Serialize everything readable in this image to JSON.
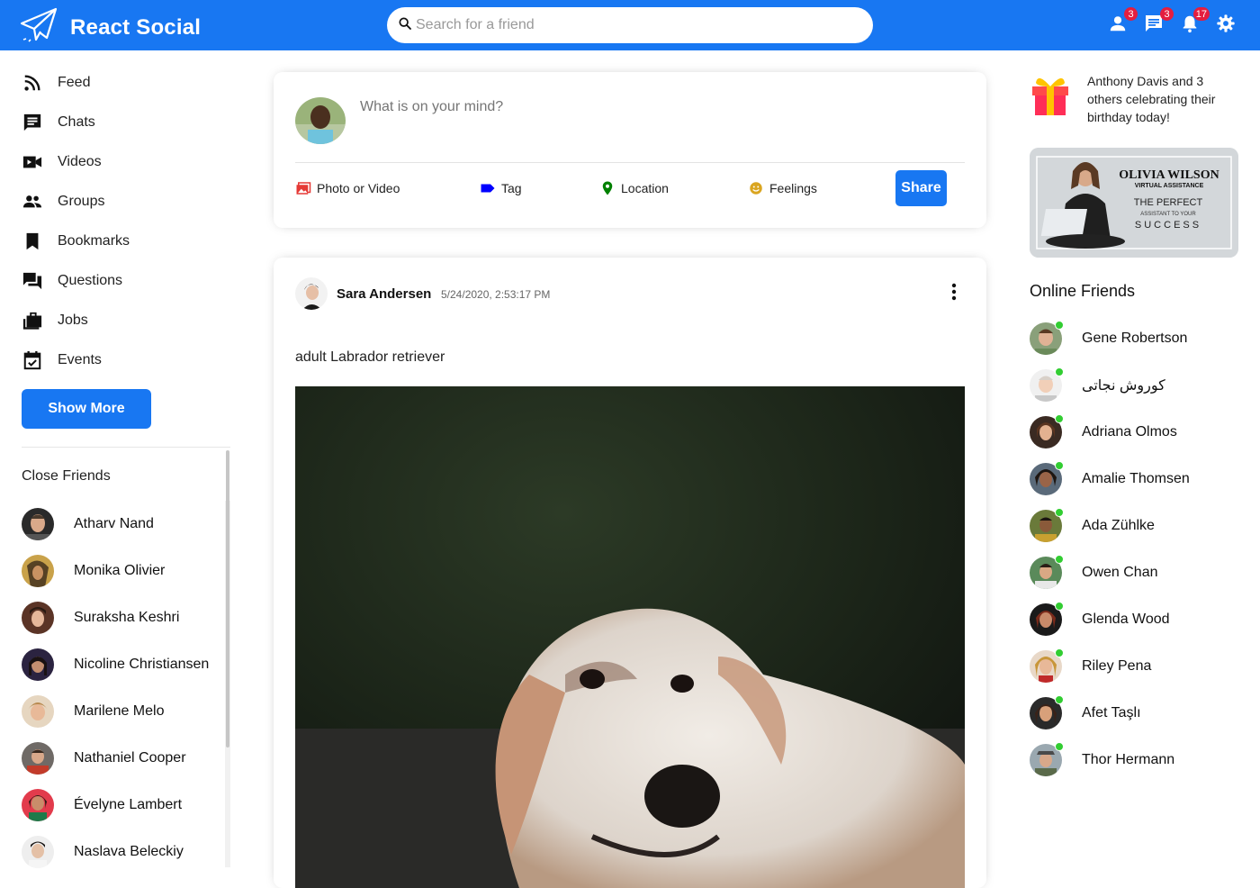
{
  "app": {
    "title": "React Social"
  },
  "search": {
    "placeholder": "Search for a friend"
  },
  "top_icons": [
    {
      "icon": "person-icon",
      "badge": "3"
    },
    {
      "icon": "chat-icon",
      "badge": "3"
    },
    {
      "icon": "bell-icon",
      "badge": "17"
    },
    {
      "icon": "gear-icon"
    }
  ],
  "sidebar": {
    "items": [
      {
        "label": "Feed",
        "icon": "rss-feed-icon"
      },
      {
        "label": "Chats",
        "icon": "chat-bubble-icon"
      },
      {
        "label": "Videos",
        "icon": "video-camera-icon"
      },
      {
        "label": "Groups",
        "icon": "group-icon"
      },
      {
        "label": "Bookmarks",
        "icon": "bookmark-icon"
      },
      {
        "label": "Questions",
        "icon": "forum-icon"
      },
      {
        "label": "Jobs",
        "icon": "work-icon"
      },
      {
        "label": "Events",
        "icon": "calendar-icon"
      }
    ],
    "show_more": "Show More",
    "close_friends_title": "Close Friends",
    "close_friends": [
      "Atharv Nand",
      "Monika Olivier",
      "Suraksha Keshri",
      "Nicoline Christiansen",
      "Marilene Melo",
      "Nathaniel Cooper",
      "Évelyne Lambert",
      "Naslava Beleckiy"
    ]
  },
  "share": {
    "placeholder": "What is on your mind?",
    "options": [
      {
        "label": "Photo or Video",
        "icon": "photo-icon",
        "color": "#e53935"
      },
      {
        "label": "Tag",
        "icon": "label-icon",
        "color": "#0000ff"
      },
      {
        "label": "Location",
        "icon": "location-pin-icon",
        "color": "#008000"
      },
      {
        "label": "Feelings",
        "icon": "emoji-icon",
        "color": "#daa520"
      }
    ],
    "button": "Share"
  },
  "post": {
    "username": "Sara Andersen",
    "date": "5/24/2020, 2:53:17 PM",
    "text": "adult Labrador retriever"
  },
  "birthday": {
    "name": "Anthony Davis",
    "rest": " and 3 others celebrating their birthday today!"
  },
  "ad": {
    "line1": "OLIVIA WILSON",
    "line2": "VIRTUAL ASSISTANCE",
    "line3": "THE PERFECT",
    "line4": "ASSISTANT TO YOUR",
    "line5": "SUCCESS"
  },
  "online_friends": {
    "title": "Online Friends",
    "list": [
      "Gene Robertson",
      "کوروش نجاتی",
      "Adriana Olmos",
      "Amalie Thomsen",
      "Ada Zühlke",
      "Owen Chan",
      "Glenda Wood",
      "Riley Pena",
      "Afet Taşlı",
      "Thor Hermann"
    ]
  },
  "colors": {
    "brand": "#1877f2",
    "online": "#32cd32",
    "badge": "#e41e3f"
  }
}
